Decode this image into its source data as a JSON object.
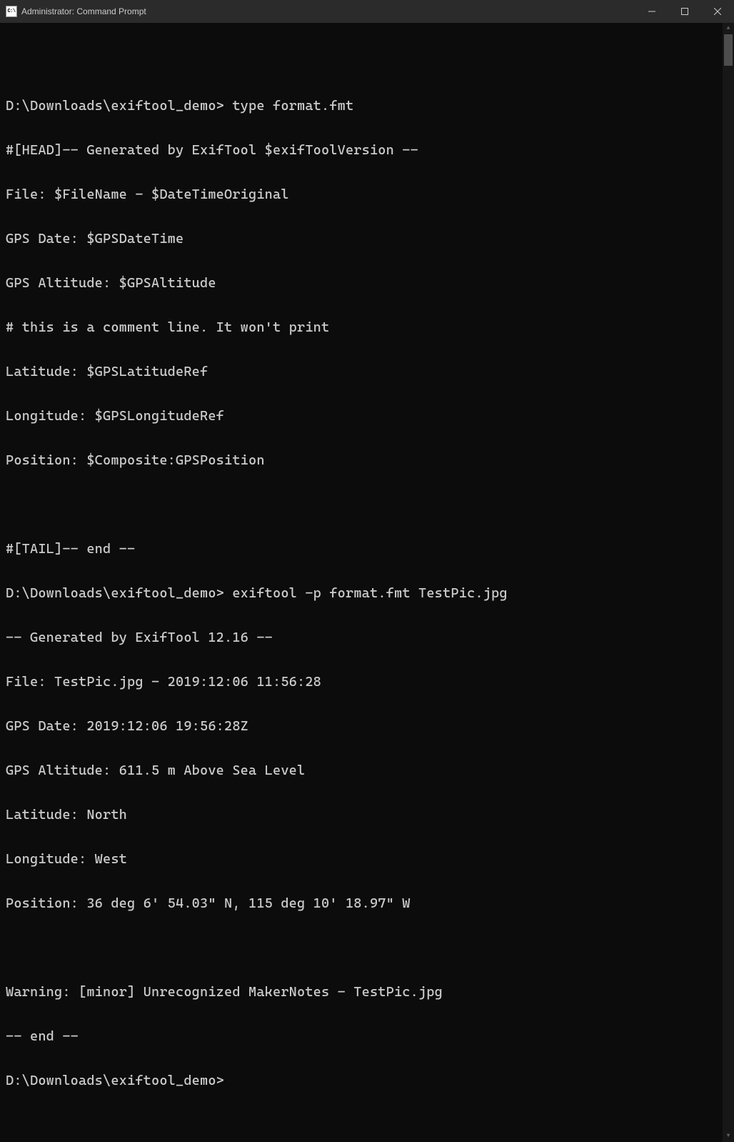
{
  "window": {
    "title": "Administrator: Command Prompt",
    "icon_text": "C:\\"
  },
  "terminal": {
    "prompt1": "D:\\Downloads\\exiftool_demo>",
    "cmd1": " type format.fmt",
    "fmt_head": "#[HEAD]-- Generated by ExifTool $exifToolVersion --",
    "fmt_file": "File: $FileName - $DateTimeOriginal",
    "fmt_gpsdate": "GPS Date: $GPSDateTime",
    "fmt_gpsalt": "GPS Altitude: $GPSAltitude",
    "fmt_comment": "# this is a comment line. It won't print",
    "fmt_lat": "Latitude: $GPSLatitudeRef",
    "fmt_lon": "Longitude: $GPSLongitudeRef",
    "fmt_pos": "Position: $Composite:GPSPosition",
    "fmt_tail": "#[TAIL]-- end --",
    "prompt2": "D:\\Downloads\\exiftool_demo>",
    "cmd2": " exiftool -p format.fmt TestPic.jpg",
    "out_head": "-- Generated by ExifTool 12.16 --",
    "out_file": "File: TestPic.jpg - 2019:12:06 11:56:28",
    "out_gpsdate": "GPS Date: 2019:12:06 19:56:28Z",
    "out_gpsalt": "GPS Altitude: 611.5 m Above Sea Level",
    "out_lat": "Latitude: North",
    "out_lon": "Longitude: West",
    "out_pos": "Position: 36 deg 6' 54.03\" N, 115 deg 10' 18.97\" W",
    "out_warn": "Warning: [minor] Unrecognized MakerNotes - TestPic.jpg",
    "out_tail": "-- end --",
    "prompt3": "D:\\Downloads\\exiftool_demo>"
  }
}
